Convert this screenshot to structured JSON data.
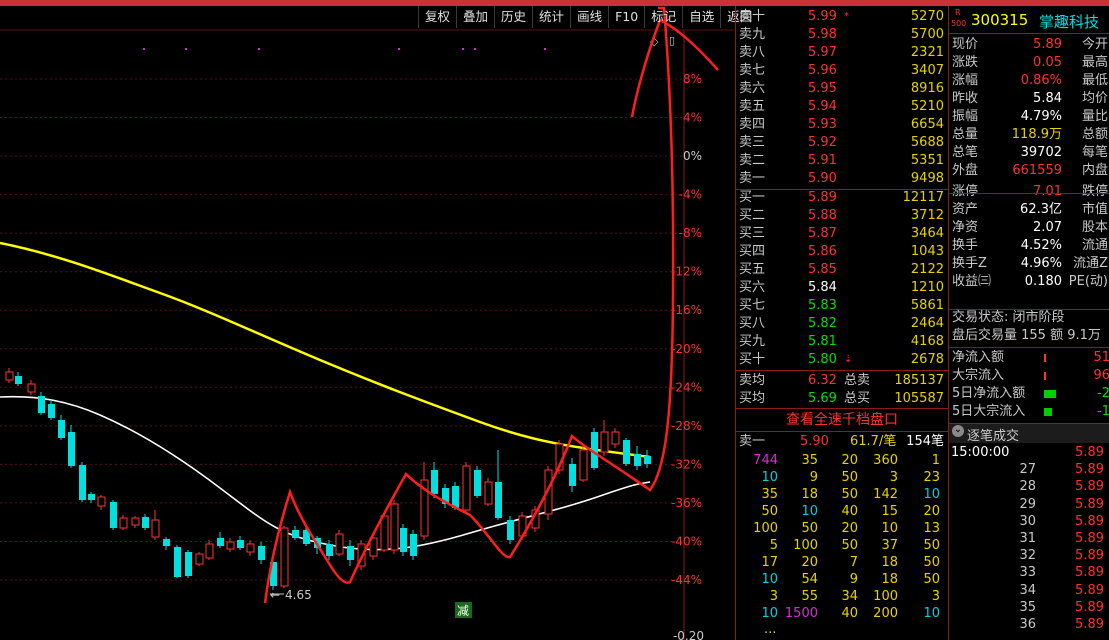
{
  "toolbar": [
    "复权",
    "叠加",
    "历史",
    "统计",
    "画线",
    "F10",
    "标记",
    "自选",
    "返回"
  ],
  "chart": {
    "y_axis_labels": [
      "8%",
      "4%",
      "0%",
      "-4%",
      "-8%",
      "-12%",
      "-16%",
      "-20%",
      "-24%",
      "-28%",
      "-32%",
      "-36%",
      "-40%",
      "-44%"
    ],
    "low_marker": "4.65",
    "bottom_label": "-0.20",
    "bottom_tag": "减",
    "colors": {
      "up": "#ff3232",
      "down": "#00e0e0",
      "ma_yellow": "#ffff00",
      "ma_white": "#ffffff",
      "annotation": "#ff1e1e"
    }
  },
  "chart_data": {
    "type": "candlestick",
    "yaxis_percent_ticks": [
      8,
      4,
      0,
      -4,
      -8,
      -12,
      -16,
      -20,
      -24,
      -28,
      -32,
      -36,
      -40,
      -44
    ],
    "low_label": 4.65,
    "series": [
      {
        "name": "candles",
        "values": []
      },
      {
        "name": "ma_yellow",
        "values": []
      },
      {
        "name": "ma_white",
        "values": []
      }
    ]
  },
  "orderbook": {
    "sell": [
      {
        "label": "卖十",
        "price": "5.99",
        "vol": "5270",
        "pc": "red",
        "flag": "*"
      },
      {
        "label": "卖九",
        "price": "5.98",
        "vol": "5700",
        "pc": "red"
      },
      {
        "label": "卖八",
        "price": "5.97",
        "vol": "2321",
        "pc": "red"
      },
      {
        "label": "卖七",
        "price": "5.96",
        "vol": "3407",
        "pc": "red"
      },
      {
        "label": "卖六",
        "price": "5.95",
        "vol": "8916",
        "pc": "red"
      },
      {
        "label": "卖五",
        "price": "5.94",
        "vol": "5210",
        "pc": "red"
      },
      {
        "label": "卖四",
        "price": "5.93",
        "vol": "6654",
        "pc": "red"
      },
      {
        "label": "卖三",
        "price": "5.92",
        "vol": "5688",
        "pc": "red"
      },
      {
        "label": "卖二",
        "price": "5.91",
        "vol": "5351",
        "pc": "red"
      },
      {
        "label": "卖一",
        "price": "5.90",
        "vol": "9498",
        "pc": "red"
      }
    ],
    "buy": [
      {
        "label": "买一",
        "price": "5.89",
        "vol": "12117",
        "pc": "red"
      },
      {
        "label": "买二",
        "price": "5.88",
        "vol": "3712",
        "pc": "red"
      },
      {
        "label": "买三",
        "price": "5.87",
        "vol": "3464",
        "pc": "red"
      },
      {
        "label": "买四",
        "price": "5.86",
        "vol": "1043",
        "pc": "red"
      },
      {
        "label": "买五",
        "price": "5.85",
        "vol": "2122",
        "pc": "red"
      },
      {
        "label": "买六",
        "price": "5.84",
        "vol": "1210",
        "pc": "wht"
      },
      {
        "label": "买七",
        "price": "5.83",
        "vol": "5861",
        "pc": "grn"
      },
      {
        "label": "买八",
        "price": "5.82",
        "vol": "2464",
        "pc": "grn"
      },
      {
        "label": "买九",
        "price": "5.81",
        "vol": "4168",
        "pc": "grn"
      },
      {
        "label": "买十",
        "price": "5.80",
        "vol": "2678",
        "pc": "grn",
        "flag": "⇣"
      }
    ],
    "avg": [
      {
        "label": "卖均",
        "price": "6.32",
        "k": "总卖",
        "vol": "185137"
      },
      {
        "label": "买均",
        "price": "5.69",
        "k": "总买",
        "vol": "105587"
      }
    ],
    "view_full": "查看全速千档盘口",
    "tick_header": {
      "label": "卖一",
      "price": "5.90",
      "avg": "61.7/笔",
      "count": "154笔"
    },
    "tick_grid": [
      [
        "744",
        "35",
        "20",
        "360",
        "1"
      ],
      [
        "10",
        "9",
        "50",
        "3",
        "23"
      ],
      [
        "35",
        "18",
        "50",
        "142",
        "10"
      ],
      [
        "50",
        "10",
        "40",
        "15",
        "20"
      ],
      [
        "100",
        "50",
        "20",
        "10",
        "13"
      ],
      [
        "5",
        "100",
        "50",
        "37",
        "50"
      ],
      [
        "17",
        "20",
        "7",
        "18",
        "50"
      ],
      [
        "10",
        "54",
        "9",
        "18",
        "50"
      ],
      [
        "3",
        "55",
        "34",
        "100",
        "3"
      ],
      [
        "10",
        "1500",
        "40",
        "200",
        "10"
      ]
    ],
    "tick_more": "..."
  },
  "info": {
    "badge_top": "R",
    "badge_bottom": "500",
    "code": "300315",
    "name": "掌趣科技",
    "rows": [
      {
        "k": "现价",
        "v": "5.89",
        "c": "red",
        "k2": "今开"
      },
      {
        "k": "涨跌",
        "v": "0.05",
        "c": "red",
        "k2": "最高"
      },
      {
        "k": "涨幅",
        "v": "0.86%",
        "c": "red",
        "k2": "最低"
      },
      {
        "k": "昨收",
        "v": "5.84",
        "c": "wht",
        "k2": "均价"
      },
      {
        "k": "振幅",
        "v": "4.79%",
        "c": "wht",
        "k2": "量比"
      },
      {
        "k": "总量",
        "v": "118.9万",
        "c": "yel",
        "k2": "总额"
      },
      {
        "k": "总笔",
        "v": "39702",
        "c": "wht",
        "k2": "每笔"
      },
      {
        "k": "外盘",
        "v": "661559",
        "c": "red",
        "k2": "内盘"
      },
      {
        "k": "涨停",
        "v": "7.01",
        "c": "red",
        "k2": "跌停"
      },
      {
        "k": "资产",
        "v": "62.3亿",
        "c": "wht",
        "k2": "市值"
      },
      {
        "k": "净资",
        "v": "2.07",
        "c": "wht",
        "k2": "股本"
      },
      {
        "k": "换手",
        "v": "4.52%",
        "c": "wht",
        "k2": "流通"
      },
      {
        "k": "换手Z",
        "v": "4.96%",
        "c": "wht",
        "k2": "流通Z"
      },
      {
        "k": "收益㈢",
        "v": "0.180",
        "c": "wht",
        "k2": "PE(动)"
      }
    ],
    "status": "交易状态: 闭市阶段",
    "after_hours": "盘后交易量 155 额 9.1万",
    "flow": [
      {
        "k": "净流入额",
        "v": "51",
        "c": "red",
        "bar": "#ff3030",
        "bw": 2
      },
      {
        "k": "大宗流入",
        "v": "96",
        "c": "red",
        "bar": "#ff3030",
        "bw": 2
      },
      {
        "k": "5日净流入额",
        "v": "-2",
        "c": "grn",
        "bar": "#00d000",
        "bw": 12
      },
      {
        "k": "5日大宗流入",
        "v": "-1",
        "c": "grn",
        "bar": "#00d000",
        "bw": 8
      }
    ],
    "trades_title": "逐笔成交",
    "trades": [
      {
        "t": "15:00:00",
        "p": "5.89"
      },
      {
        "t": "27",
        "p": "5.89"
      },
      {
        "t": "28",
        "p": "5.89"
      },
      {
        "t": "29",
        "p": "5.89"
      },
      {
        "t": "30",
        "p": "5.89"
      },
      {
        "t": "31",
        "p": "5.89"
      },
      {
        "t": "32",
        "p": "5.89"
      },
      {
        "t": "33",
        "p": "5.89"
      },
      {
        "t": "34",
        "p": "5.89"
      },
      {
        "t": "35",
        "p": "5.89"
      },
      {
        "t": "36",
        "p": "5.89"
      }
    ]
  }
}
